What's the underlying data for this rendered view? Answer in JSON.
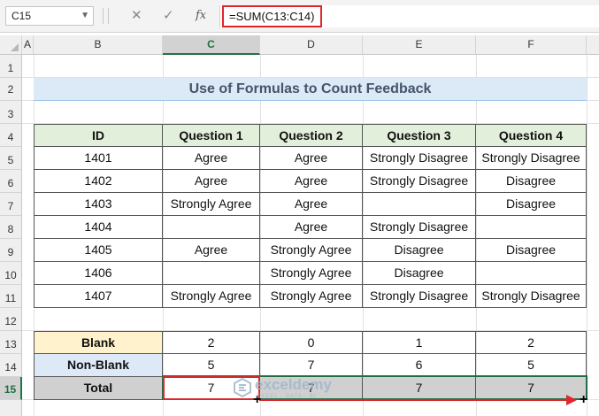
{
  "formula_bar": {
    "name_box": "C15",
    "cancel_icon": "✕",
    "enter_icon": "✓",
    "fx_label": "fx",
    "formula": "=SUM(C13:C14)"
  },
  "columns": [
    "A",
    "B",
    "C",
    "D",
    "E",
    "F"
  ],
  "rows": [
    "1",
    "2",
    "3",
    "4",
    "5",
    "6",
    "7",
    "8",
    "9",
    "10",
    "11",
    "12",
    "13",
    "14",
    "15"
  ],
  "title": "Use of Formulas to Count Feedback",
  "table": {
    "headers": [
      "ID",
      "Question 1",
      "Question 2",
      "Question 3",
      "Question 4"
    ],
    "rows": [
      [
        "1401",
        "Agree",
        "Agree",
        "Strongly Disagree",
        "Strongly Disagree"
      ],
      [
        "1402",
        "Agree",
        "Agree",
        "Strongly Disagree",
        "Disagree"
      ],
      [
        "1403",
        "Strongly Agree",
        "Agree",
        "",
        "Disagree"
      ],
      [
        "1404",
        "",
        "Agree",
        "Strongly Disagree",
        ""
      ],
      [
        "1405",
        "Agree",
        "Strongly Agree",
        "Disagree",
        "Disagree"
      ],
      [
        "1406",
        "",
        "Strongly Agree",
        "Disagree",
        ""
      ],
      [
        "1407",
        "Strongly Agree",
        "Strongly Agree",
        "Strongly Disagree",
        "Strongly Disagree"
      ]
    ]
  },
  "summary": {
    "blank": {
      "label": "Blank",
      "values": [
        "2",
        "0",
        "1",
        "2"
      ]
    },
    "non_blank": {
      "label": "Non-Blank",
      "values": [
        "5",
        "7",
        "6",
        "5"
      ]
    },
    "total": {
      "label": "Total",
      "values": [
        "7",
        "7",
        "7",
        "7"
      ]
    }
  },
  "watermark": {
    "name": "exceldemy",
    "tagline": "EXCEL · DATA · BI"
  },
  "colors": {
    "accent_green": "#217346",
    "highlight_red": "#e0262a",
    "header_fill": "#e2efda"
  }
}
